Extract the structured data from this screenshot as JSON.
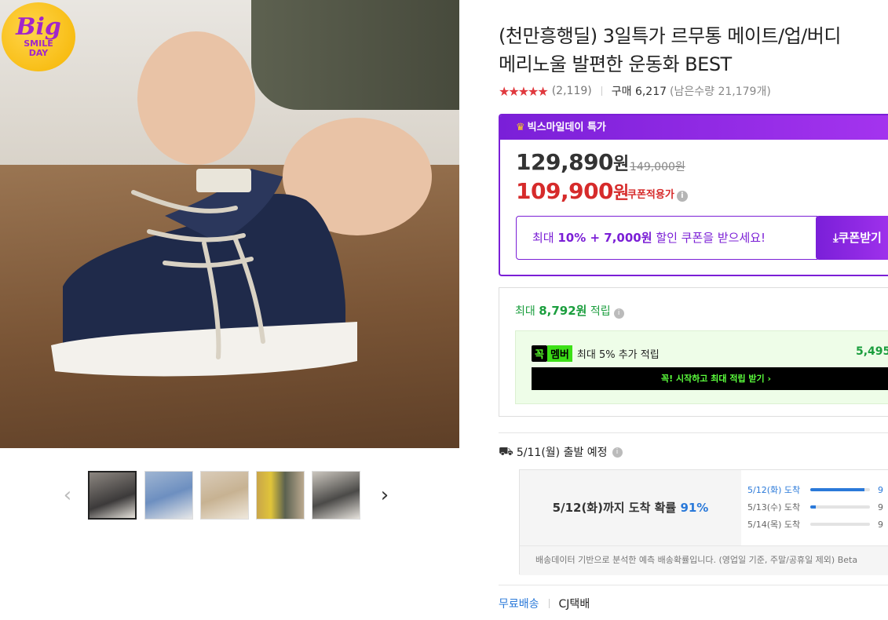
{
  "badge": {
    "big": "Big",
    "line1": "SMILE",
    "line2": "DAY"
  },
  "gallery": {
    "prev_arrow": "‹",
    "next_arrow": "›",
    "thumbnails": [
      {
        "bg": "#6f6a64"
      },
      {
        "bg": "#8aa3c2"
      },
      {
        "bg": "#c9b8a4"
      },
      {
        "bg": "#a89a6a"
      },
      {
        "bg": "#a49d93"
      }
    ]
  },
  "product": {
    "title_line1": "(천만흥행딜) 3일특가 르무통 메이트/업/버디",
    "title_line2": "메리노울 발편한 운동화 BEST",
    "stars": "★★★★★",
    "review_count": "(2,119)",
    "purchase": "구매 6,217",
    "remaining": "(남은수량 21,179개)"
  },
  "promo": {
    "header": "빅스마일데이 특가",
    "price_original": "129,890",
    "price_unit": "원",
    "price_strike": "149,000원",
    "price_sale": "109,900",
    "coupon_tag": "쿠폰적용가",
    "coupon_msg_prefix": "최대 ",
    "coupon_msg_bold": "10% + 7,000원",
    "coupon_msg_suffix": " 할인 쿠폰을 받으세요!",
    "coupon_button": "⤓쿠폰받기"
  },
  "reward": {
    "prefix": "최대 ",
    "amount": "8,792원",
    "suffix": " 적립",
    "member_kkok": "꼭",
    "member_label": "멤버",
    "member_text": "최대 5% 추가 적립",
    "member_value": "5,495",
    "member_button": "꼭! 시작하고 최대 적립 받기 ›"
  },
  "shipping": {
    "departure": "5/11(월) 출발 예정",
    "prob_title_prefix": "5/12(화)까지 도착 확률 ",
    "prob_title_pct": "91%",
    "probabilities": [
      {
        "label": "5/12(화) 도착",
        "value": 91,
        "pct_text": "9"
      },
      {
        "label": "5/13(수) 도착",
        "value": 9,
        "pct_text": "9"
      },
      {
        "label": "5/14(목) 도착",
        "value": 0,
        "pct_text": "9"
      }
    ],
    "note": "배송데이터 기반으로 분석한 예측 배송확률입니다. (영업일 기준, 주말/공휴일 제외) Beta",
    "free_shipping": "무료배송",
    "carrier": "CJ택배"
  }
}
